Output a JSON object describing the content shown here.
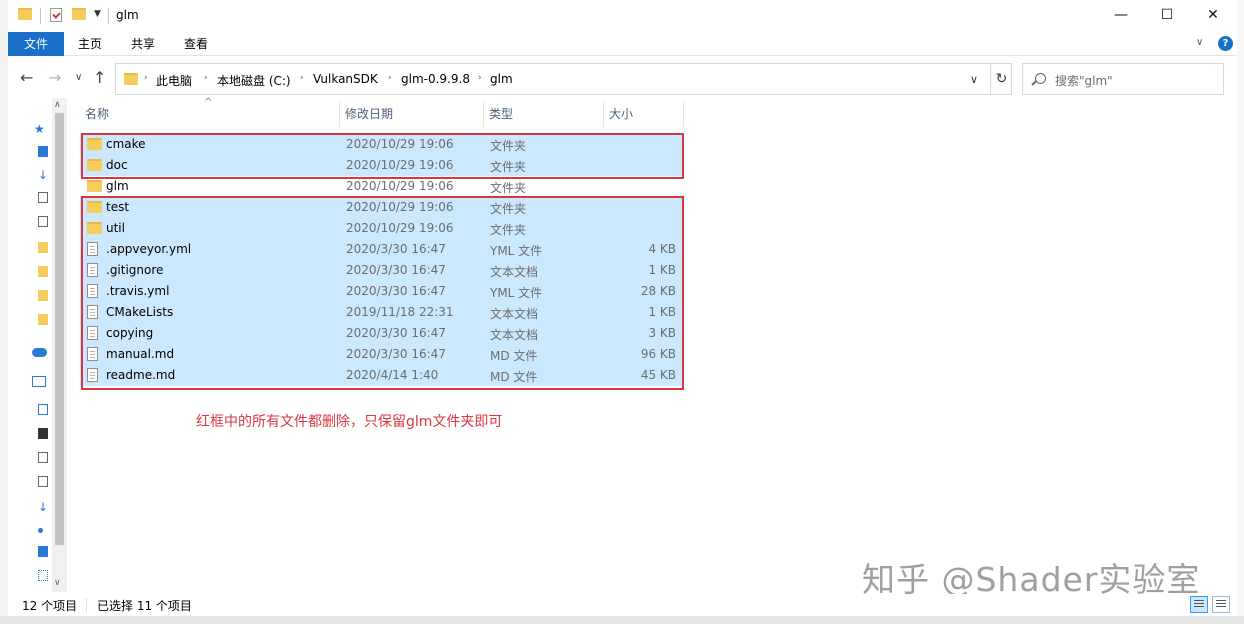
{
  "window": {
    "title": "glm",
    "minimize": "—",
    "maximize": "☐",
    "close": "✕"
  },
  "ribbon": {
    "tabs": [
      "文件",
      "主页",
      "共享",
      "查看"
    ],
    "help": "?"
  },
  "address": {
    "breadcrumbs": [
      "此电脑",
      "本地磁盘 (C:)",
      "VulkanSDK",
      "glm-0.9.9.8",
      "glm"
    ],
    "search_placeholder": "搜索\"glm\""
  },
  "columns": {
    "name": "名称",
    "date": "修改日期",
    "type": "类型",
    "size": "大小"
  },
  "files": [
    {
      "name": "cmake",
      "date": "2020/10/29 19:06",
      "type": "文件夹",
      "size": "",
      "kind": "folder",
      "selected": true
    },
    {
      "name": "doc",
      "date": "2020/10/29 19:06",
      "type": "文件夹",
      "size": "",
      "kind": "folder",
      "selected": true
    },
    {
      "name": "glm",
      "date": "2020/10/29 19:06",
      "type": "文件夹",
      "size": "",
      "kind": "folder",
      "selected": false
    },
    {
      "name": "test",
      "date": "2020/10/29 19:06",
      "type": "文件夹",
      "size": "",
      "kind": "folder",
      "selected": true
    },
    {
      "name": "util",
      "date": "2020/10/29 19:06",
      "type": "文件夹",
      "size": "",
      "kind": "folder",
      "selected": true
    },
    {
      "name": ".appveyor.yml",
      "date": "2020/3/30 16:47",
      "type": "YML 文件",
      "size": "4 KB",
      "kind": "file",
      "selected": true
    },
    {
      "name": ".gitignore",
      "date": "2020/3/30 16:47",
      "type": "文本文档",
      "size": "1 KB",
      "kind": "file",
      "selected": true
    },
    {
      "name": ".travis.yml",
      "date": "2020/3/30 16:47",
      "type": "YML 文件",
      "size": "28 KB",
      "kind": "file",
      "selected": true
    },
    {
      "name": "CMakeLists",
      "date": "2019/11/18 22:31",
      "type": "文本文档",
      "size": "1 KB",
      "kind": "file",
      "selected": true
    },
    {
      "name": "copying",
      "date": "2020/3/30 16:47",
      "type": "文本文档",
      "size": "3 KB",
      "kind": "file",
      "selected": true
    },
    {
      "name": "manual.md",
      "date": "2020/3/30 16:47",
      "type": "MD 文件",
      "size": "96 KB",
      "kind": "file",
      "selected": true
    },
    {
      "name": "readme.md",
      "date": "2020/4/14 1:40",
      "type": "MD 文件",
      "size": "45 KB",
      "kind": "file",
      "selected": true
    }
  ],
  "annotation": "红框中的所有文件都删除，只保留glm文件夹即可",
  "watermark": "知乎 @Shader实验室",
  "status": {
    "item_count": "12 个项目",
    "selected_count": "已选择 11 个项目"
  },
  "colors": {
    "accent": "#1a6fc9",
    "selection": "#cce8ff",
    "annotation_red": "#d9363e"
  }
}
